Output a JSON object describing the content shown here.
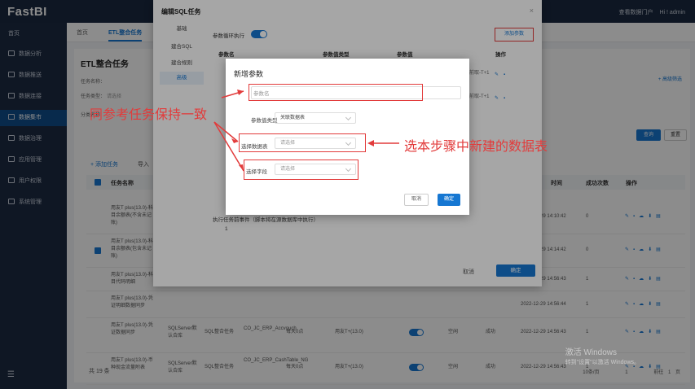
{
  "app": {
    "logo": "FastBI",
    "top_right_link": "查看数据门户",
    "user": "Hi ! admin"
  },
  "sidebar": {
    "items": [
      {
        "label": "首页"
      },
      {
        "label": "数据分析"
      },
      {
        "label": "数据推送"
      },
      {
        "label": "数据连接"
      },
      {
        "label": "数据集市"
      },
      {
        "label": "数据治理"
      },
      {
        "label": "应用管理"
      },
      {
        "label": "用户权限"
      },
      {
        "label": "系统管理"
      }
    ],
    "collapse_glyph": "☰"
  },
  "main": {
    "tabs": [
      {
        "label": "首页"
      },
      {
        "label": "ETL整合任务"
      }
    ],
    "panel_title": "ETL整合任务",
    "advanced_filter": "+ 高级筛选",
    "form": {
      "task_name_label": "任务名称：",
      "task_type_label": "任务类型：",
      "task_type_value": "请选择",
      "task_category_label": "分类名称"
    },
    "search_button": "查询",
    "reset_button": "重置",
    "add_task": "+ 添加任务",
    "import": "导入",
    "table_headers": {
      "name": "任务名称",
      "time": "时间",
      "success": "成功次数",
      "ops": "操作"
    },
    "rows": [
      {
        "name": "用友T plus(13.0)-科目余额表(不含未记账)",
        "time": "2022-12-29 14:10:42",
        "count": "0"
      },
      {
        "name": "用友T plus(13.0)-科目余额表(包含未记账)",
        "time": "2022-12-29 14:14:42",
        "count": "0"
      },
      {
        "name": "用友T plus(13.0)-科目代码明细",
        "time": "2022-12-29 14:56:43",
        "count": "1"
      },
      {
        "name": "用友T plus(13.0)-凭证明细数据同步",
        "time": "2022-12-29 14:56:44",
        "count": "1"
      },
      {
        "name": "用友T plus(13.0)-凭证数据同步",
        "type": "SQLServer默认合库",
        "kind": "SQL整合任务",
        "code": "CO_JC_ERP_Accvouch",
        "sched": "每天0点",
        "source": "用友T+(13.0)",
        "status": "空闲",
        "result": "成功",
        "time": "2022-12-29 14:56:43",
        "count": "1"
      },
      {
        "name": "用友T plus(13.0)-币种现金流量附表",
        "type": "SQLServer默认合库",
        "kind": "SQL整合任务",
        "code": "CO_JC_ERP_CashTable_NG",
        "sched": "每天0点",
        "source": "用友T+(13.0)",
        "status": "空闲",
        "result": "成功",
        "time": "2022-12-29 14:56:43",
        "count": "1"
      },
      {
        "name": "用友T plus(13.0)-",
        "type": "SQLServer默",
        "kind": "SQL整合任务",
        "code": "CO_JC_ERP_Accvouch_N",
        "sched": "每天0点",
        "source": "用友T+(13.0)",
        "status": "空闲",
        "result": "成功",
        "time": "2022-12-29 14:56:43",
        "count": "1"
      }
    ],
    "total": "共 19 条",
    "pagination": {
      "page_size": "10条/页",
      "current": "1",
      "goto": "前往",
      "page": "1",
      "unit": "页"
    }
  },
  "sql_dialog": {
    "title": "编辑SQL任务",
    "close": "×",
    "nav": [
      "基础",
      "建合SQL",
      "建合规则",
      "高级"
    ],
    "param_toggle_label": "参数循环执行",
    "add_param_button": "添加参数",
    "table_headers": {
      "name": "参数名",
      "type": "参数值类型",
      "value": "参数值",
      "ops": "操作"
    },
    "rows": [
      {
        "value": "前取-T+1"
      },
      {
        "value": "前取-T+1"
      }
    ],
    "event_label": "执行任务前事件（脚本将在源数据库中执行）",
    "editor_line": "1",
    "cancel": "取消",
    "ok": "确定"
  },
  "new_param_dialog": {
    "title": "新增参数",
    "name_placeholder": "参数名",
    "value_type_label": "参数值类型",
    "value_type_value": "关联数据表",
    "table_label": "选择数据表",
    "table_placeholder": "请选择",
    "field_label": "选择字段",
    "field_placeholder": "请选择",
    "cancel": "取消",
    "ok": "确定"
  },
  "annotations": {
    "left": "同参考任务保持一致",
    "right": "选本步骤中新建的数据表"
  },
  "watermark": {
    "line1": "激活 Windows",
    "line2": "转到\"设置\"以激活 Windows。"
  },
  "colors": {
    "primary": "#1677d2",
    "annotation": "#e23b3b",
    "sidebar": "#1d2b42"
  }
}
